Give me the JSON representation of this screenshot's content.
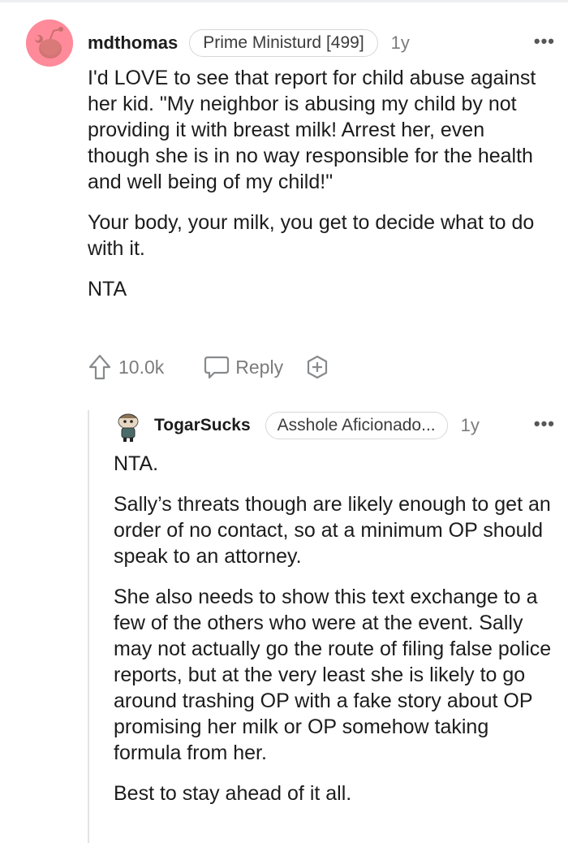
{
  "comment": {
    "username": "mdthomas",
    "flair": "Prime Ministurd [499]",
    "age": "1y",
    "more": "•••",
    "paragraphs": [
      "I'd LOVE to see that report for child abuse against her kid. \"My neighbor is abusing my child by not providing it with breast milk! Arrest her, even though she is in no way responsible for the health and well being of my child!\"",
      "Your body, your milk, you get to decide what to do with it.",
      "NTA"
    ],
    "upvotes": "10.0k",
    "reply_label": "Reply",
    "icons": {
      "upvote": "upvote-arrow-icon",
      "reply": "speech-bubble-icon",
      "award": "award-plus-icon",
      "avatar": "snoo-avatar"
    },
    "avatar_color": "#ff8a9a"
  },
  "reply": {
    "username": "TogarSucks",
    "flair": "Asshole Aficionado...",
    "age": "1y",
    "more": "•••",
    "paragraphs": [
      "NTA.",
      "Sally’s threats though are likely enough to get an order of no contact, so at a minimum OP should speak to an attorney.",
      "She also needs to show this text exchange to a few of the others who were at the event. Sally may not actually go the route of filing false police reports, but at the very least she is likely to go around trashing OP with a fake story about OP promising her milk or OP somehow taking formula from her.",
      "Best to stay ahead of it all."
    ]
  }
}
